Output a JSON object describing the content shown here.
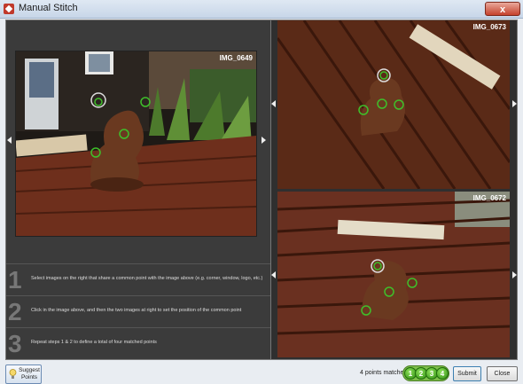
{
  "window": {
    "title": "Manual Stitch",
    "close_glyph": "x"
  },
  "main_image": {
    "label": "IMG_0649"
  },
  "right_images": [
    {
      "label": "IMG_0673"
    },
    {
      "label": "IMG_0672"
    }
  ],
  "steps": [
    {
      "number": "1",
      "text": "Select images on the right that share a common point with the image above (e.g. corner, window, logo, etc.)"
    },
    {
      "number": "2",
      "text": "Click in the image above, and then the two images at right to set the position of the common point"
    },
    {
      "number": "3",
      "text": "Repeat steps 1 & 2 to define a total of four matched points"
    }
  ],
  "footer": {
    "suggest_label": "Suggest Points",
    "matched_text": "4 points matched",
    "badges": [
      "1",
      "2",
      "3",
      "4"
    ],
    "submit_label": "Submit",
    "close_label": "Close"
  },
  "colors": {
    "match_marker": "#3fbf2a",
    "accent": "#3c7fb1"
  }
}
